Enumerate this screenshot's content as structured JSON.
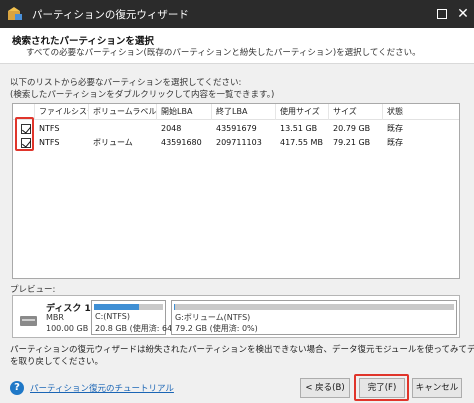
{
  "window": {
    "title": "パーティションの復元ウィザード"
  },
  "panel": {
    "heading": "検索されたパーティションを選択",
    "subheading": "すべての必要なパーティション(既存のパーティションと紛失したパーティション)を選択してください。"
  },
  "instructions": {
    "line1": "以下のリストから必要なパーティションを選択してください:",
    "line2": "(検索したパーティションをダブルクリックして内容を一覧できます。)"
  },
  "table": {
    "columns": [
      "ファイルシステム",
      "ボリュームラベル",
      "開始LBA",
      "終了LBA",
      "使用サイズ",
      "サイズ",
      "状態"
    ],
    "rows": [
      {
        "checked": true,
        "filesystem": "NTFS",
        "label": "",
        "start_lba": "2048",
        "end_lba": "43591679",
        "used": "13.51 GB",
        "size": "20.79 GB",
        "status": "既存"
      },
      {
        "checked": true,
        "filesystem": "NTFS",
        "label": "ボリューム",
        "start_lba": "43591680",
        "end_lba": "209711103",
        "used": "417.55 MB",
        "size": "79.21 GB",
        "status": "既存"
      }
    ]
  },
  "preview": {
    "label": "プレビュー:",
    "disk": {
      "name": "ディスク 1",
      "type": "MBR",
      "size": "100.00 GB"
    },
    "partitions": [
      {
        "name": "C:(NTFS)",
        "detail": "20.8 GB (使用済: 64",
        "used_fraction": 0.65
      },
      {
        "name": "G:ボリューム(NTFS)",
        "detail": "79.2 GB (使用済: 0%)",
        "used_fraction": 0.005
      }
    ]
  },
  "note": {
    "line1": "パーティションの復元ウィザードは紛失されたパーティションを検出できない場合、データ復元モジュールを使ってみてデータ",
    "line2": "を取り戻してください。"
  },
  "footer": {
    "tutorial_link": "パーティション復元のチュートリアル",
    "back_button": "< 戻る(B)",
    "finish_button": "完了(F)",
    "cancel_button": "キャンセル"
  },
  "colors": {
    "titlebar": "#2b2b2b",
    "highlight": "#e0352b",
    "usage_bar": "#3f8fd4",
    "link": "#1a65b5"
  },
  "icons": {
    "app": "partition-wizard-icon",
    "help": "question-circle-icon",
    "disk": "hard-disk-icon"
  }
}
